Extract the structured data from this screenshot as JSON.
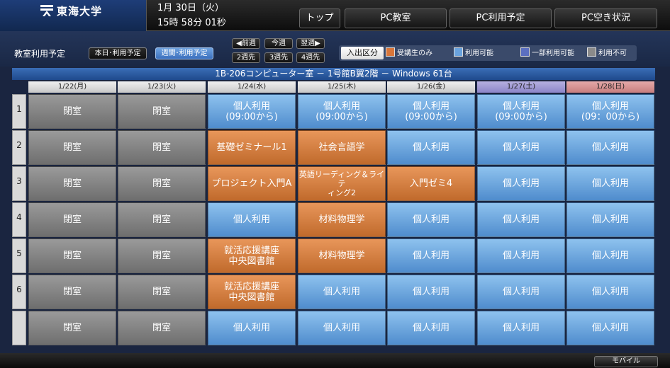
{
  "header": {
    "logo_text": "東海大学",
    "date": "1月 30日（火）",
    "time": "15時 58分 01秒",
    "nav": [
      "トップ",
      "PC教室",
      "PC利用予定",
      "PC空き状況"
    ]
  },
  "toolbar": {
    "label": "教室利用予定",
    "today_button": "本日･利用予定",
    "week_button": "週間･利用予定",
    "week_nav": [
      "◀前週",
      "今週",
      "翌週▶",
      "2週先",
      "3週先",
      "4週先"
    ]
  },
  "legend": {
    "title": "入出区分",
    "items": [
      {
        "label": "受講生のみ",
        "color": "#d8763a"
      },
      {
        "label": "利用可能",
        "color": "#6aa3de"
      },
      {
        "label": "一部利用可能",
        "color": "#5b6fc0"
      },
      {
        "label": "利用不可",
        "color": "#8a8a8a"
      }
    ]
  },
  "room": "1B-206コンピューター室 － 1号館B翼2階 － Windows 61台",
  "days": [
    "1/22(月)",
    "1/23(火)",
    "1/24(水)",
    "1/25(木)",
    "1/26(金)",
    "1/27(土)",
    "1/28(日)"
  ],
  "periods": [
    "1",
    "2",
    "3",
    "4",
    "5",
    "6",
    ""
  ],
  "grid": [
    [
      {
        "t": "閉室",
        "s": "closed"
      },
      {
        "t": "閉室",
        "s": "closed"
      },
      {
        "t": "個人利用\n(09:00から)",
        "s": "avail"
      },
      {
        "t": "個人利用\n(09:00から)",
        "s": "avail"
      },
      {
        "t": "個人利用\n(09:00から)",
        "s": "avail"
      },
      {
        "t": "個人利用\n(09:00から)",
        "s": "avail"
      },
      {
        "t": "個人利用\n(09：00から)",
        "s": "avail"
      }
    ],
    [
      {
        "t": "閉室",
        "s": "closed"
      },
      {
        "t": "閉室",
        "s": "closed"
      },
      {
        "t": "基礎ゼミナール1",
        "s": "class"
      },
      {
        "t": "社会言語学",
        "s": "class"
      },
      {
        "t": "個人利用",
        "s": "avail"
      },
      {
        "t": "個人利用",
        "s": "avail"
      },
      {
        "t": "個人利用",
        "s": "avail"
      }
    ],
    [
      {
        "t": "閉室",
        "s": "closed"
      },
      {
        "t": "閉室",
        "s": "closed"
      },
      {
        "t": "プロジェクト入門A",
        "s": "class"
      },
      {
        "t": "英語リーディング＆ライテ\nィング2",
        "s": "class small"
      },
      {
        "t": "入門ゼミ4",
        "s": "class"
      },
      {
        "t": "個人利用",
        "s": "avail"
      },
      {
        "t": "個人利用",
        "s": "avail"
      }
    ],
    [
      {
        "t": "閉室",
        "s": "closed"
      },
      {
        "t": "閉室",
        "s": "closed"
      },
      {
        "t": "個人利用",
        "s": "avail"
      },
      {
        "t": "材料物理学",
        "s": "class"
      },
      {
        "t": "個人利用",
        "s": "avail"
      },
      {
        "t": "個人利用",
        "s": "avail"
      },
      {
        "t": "個人利用",
        "s": "avail"
      }
    ],
    [
      {
        "t": "閉室",
        "s": "closed"
      },
      {
        "t": "閉室",
        "s": "closed"
      },
      {
        "t": "就活応援講座\n中央図書館",
        "s": "class"
      },
      {
        "t": "材料物理学",
        "s": "class"
      },
      {
        "t": "個人利用",
        "s": "avail"
      },
      {
        "t": "個人利用",
        "s": "avail"
      },
      {
        "t": "個人利用",
        "s": "avail"
      }
    ],
    [
      {
        "t": "閉室",
        "s": "closed"
      },
      {
        "t": "閉室",
        "s": "closed"
      },
      {
        "t": "就活応援講座\n中央図書館",
        "s": "class"
      },
      {
        "t": "個人利用",
        "s": "avail"
      },
      {
        "t": "個人利用",
        "s": "avail"
      },
      {
        "t": "個人利用",
        "s": "avail"
      },
      {
        "t": "個人利用",
        "s": "avail"
      }
    ],
    [
      {
        "t": "閉室",
        "s": "closed"
      },
      {
        "t": "閉室",
        "s": "closed"
      },
      {
        "t": "個人利用",
        "s": "avail"
      },
      {
        "t": "個人利用",
        "s": "avail"
      },
      {
        "t": "個人利用",
        "s": "avail"
      },
      {
        "t": "個人利用",
        "s": "avail"
      },
      {
        "t": "個人利用",
        "s": "avail"
      }
    ]
  ],
  "footer": {
    "mobile": "モバイル"
  }
}
